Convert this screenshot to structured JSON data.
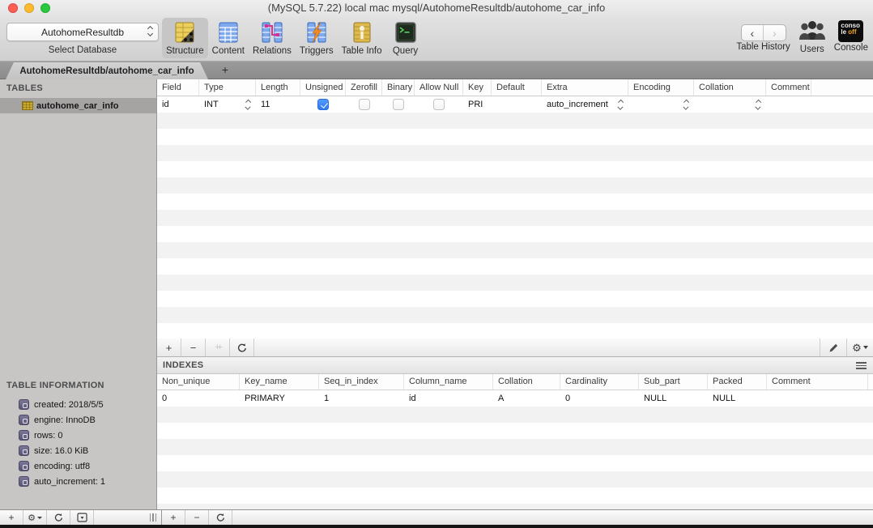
{
  "window": {
    "title": "(MySQL 5.7.22) local mac mysql/AutohomeResultdb/autohome_car_info"
  },
  "toolbar": {
    "database_select": {
      "value": "AutohomeResultdb",
      "label": "Select Database"
    },
    "view_buttons": [
      {
        "label": "Structure",
        "active": true
      },
      {
        "label": "Content",
        "active": false
      },
      {
        "label": "Relations",
        "active": false
      },
      {
        "label": "Triggers",
        "active": false
      },
      {
        "label": "Table Info",
        "active": false
      },
      {
        "label": "Query",
        "active": false
      }
    ],
    "table_history": {
      "label": "Table History",
      "back": "‹",
      "forward": "›"
    },
    "users": {
      "label": "Users"
    },
    "console": {
      "label": "Console",
      "badge_line1": "conso",
      "badge_line2": "le ",
      "badge_off": "off"
    }
  },
  "tabbar": {
    "active_tab": "AutohomeResultdb/autohome_car_info",
    "add_tab": "+"
  },
  "sidebar": {
    "tables_header": "TABLES",
    "tables": [
      {
        "name": "autohome_car_info",
        "selected": true
      }
    ],
    "info_header": "TABLE INFORMATION",
    "info_items": [
      "created: 2018/5/5",
      "engine: InnoDB",
      "rows: 0",
      "size: 16.0 KiB",
      "encoding: utf8",
      "auto_increment: 1"
    ]
  },
  "structure": {
    "columns": [
      "Field",
      "Type",
      "Length",
      "Unsigned",
      "Zerofill",
      "Binary",
      "Allow Null",
      "Key",
      "Default",
      "Extra",
      "Encoding",
      "Collation",
      "Comment"
    ],
    "row": {
      "field": "id",
      "type": "INT",
      "length": "11",
      "unsigned": true,
      "zerofill": false,
      "binary": false,
      "allow_null": false,
      "key": "PRI",
      "default": "",
      "extra": "auto_increment",
      "encoding": "",
      "collation": "",
      "comment": ""
    }
  },
  "structure_toolbar": {
    "add": "+",
    "remove": "−",
    "duplicate": "++",
    "refresh": "refresh",
    "edit": "edit",
    "gear": "⚙"
  },
  "indexes": {
    "section_title": "INDEXES",
    "columns": [
      "Non_unique",
      "Key_name",
      "Seq_in_index",
      "Column_name",
      "Collation",
      "Cardinality",
      "Sub_part",
      "Packed",
      "Comment"
    ],
    "row": [
      "0",
      "PRIMARY",
      "1",
      "id",
      "A",
      "0",
      "NULL",
      "NULL",
      ""
    ]
  },
  "bottom_toolbar": {
    "add_table": "+",
    "gear": "⚙",
    "index_add": "+",
    "index_remove": "−"
  },
  "colors": {
    "accent_blue": "#2e7bf2",
    "selected_gray": "#a6a4a3",
    "structure_yellow": "#e8c84a",
    "trigger_orange": "#f08a24",
    "relation_pink": "#d8318f",
    "query_green": "#54d45e"
  }
}
